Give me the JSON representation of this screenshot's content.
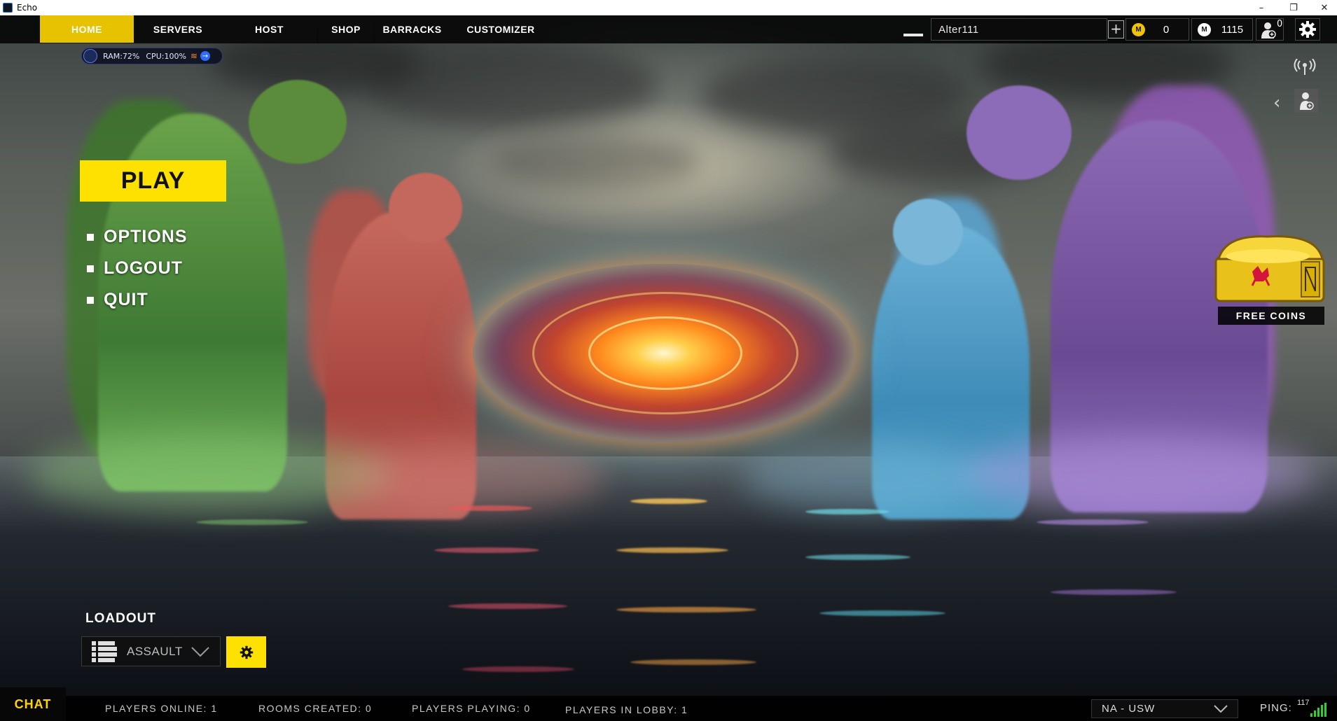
{
  "window": {
    "title": "Echo",
    "minimize": "–",
    "restore": "❐",
    "close": "✕"
  },
  "nav": {
    "tabs": [
      {
        "label": "HOME",
        "active": true
      },
      {
        "label": "SERVERS",
        "active": false
      },
      {
        "label": "HOST",
        "active": false
      },
      {
        "label": "SHOP",
        "active": false
      },
      {
        "label": "BARRACKS",
        "active": false
      },
      {
        "label": "CUSTOMIZER",
        "active": false
      }
    ]
  },
  "account": {
    "username": "Alter111",
    "add_label": "+",
    "gold_coin_icon": "M",
    "gold_coins": "0",
    "white_coin_icon": "M",
    "white_coins": "1115",
    "invites_count": "0"
  },
  "sysmon": {
    "ram": "RAM:72%",
    "cpu": "CPU:100%"
  },
  "menu": {
    "play_label": "PLAY",
    "items": [
      {
        "label": "OPTIONS"
      },
      {
        "label": "LOGOUT"
      },
      {
        "label": "QUIT"
      }
    ]
  },
  "free_coins": {
    "label": "FREE COINS"
  },
  "loadout": {
    "label": "LOADOUT",
    "selected": "ASSAULT"
  },
  "bottom": {
    "chat_label": "CHAT",
    "players_online": "PLAYERS ONLINE: 1",
    "rooms_created": "ROOMS CREATED: 0",
    "players_playing": "PLAYERS PLAYING: 0",
    "players_in_lobby": "PLAYERS IN LOBBY: 1",
    "region": "NA - USW",
    "ping_label": "PING:",
    "ping_value": "117"
  },
  "colors": {
    "accent_yellow": "#ffe100",
    "tab_active": "#e6c200",
    "ping_green": "#2fd12f"
  }
}
